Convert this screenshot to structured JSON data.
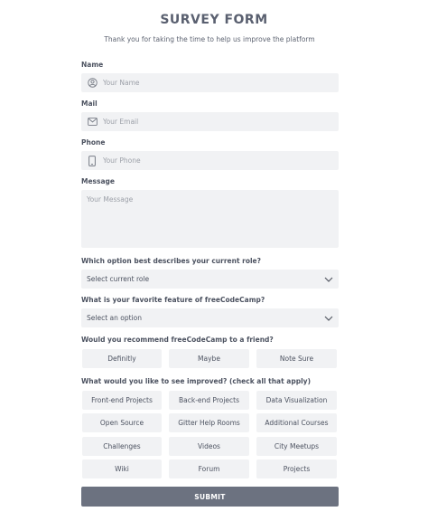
{
  "header": {
    "title": "SURVEY FORM",
    "subtitle": "Thank you for taking the time to help us improve the platform"
  },
  "fields": {
    "name": {
      "label": "Name",
      "placeholder": "Your Name",
      "icon": "user-icon"
    },
    "mail": {
      "label": "Mail",
      "placeholder": "Your Email",
      "icon": "envelope-icon"
    },
    "phone": {
      "label": "Phone",
      "placeholder": "Your Phone",
      "icon": "phone-icon"
    },
    "message": {
      "label": "Message",
      "placeholder": "Your Message"
    }
  },
  "role": {
    "question": "Which option best describes your current role?",
    "selected": "Select current role"
  },
  "feature": {
    "question": "What is your favorite feature of freeCodeCamp?",
    "selected": "Select an option"
  },
  "recommend": {
    "question": "Would you recommend freeCodeCamp to a friend?",
    "options": [
      "Definitly",
      "Maybe",
      "Note Sure"
    ]
  },
  "improve": {
    "question": "What would you like to see improved? (check all that apply)",
    "options": [
      "Front-end Projects",
      "Back-end Projects",
      "Data Visualization",
      "Open Source",
      "Gitter Help Rooms",
      "Additional Courses",
      "Challenges",
      "Videos",
      "City Meetups",
      "Wiki",
      "Forum",
      "Projects"
    ]
  },
  "submit_label": "SUBMIT",
  "colors": {
    "field_bg": "#f1f2f4",
    "button_bg": "#6c7280",
    "title": "#5a6070"
  }
}
